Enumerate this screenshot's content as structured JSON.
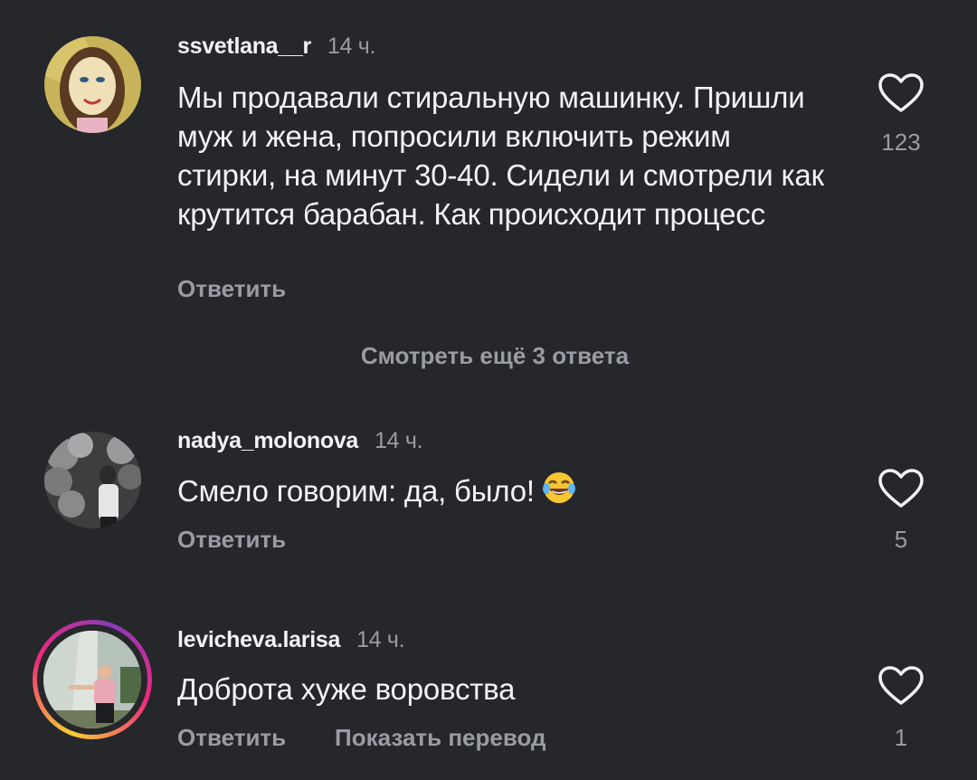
{
  "comments": [
    {
      "username": "ssvetlana__r",
      "time": "14 ч.",
      "text": "Мы продавали стиральную машинку. Пришли муж и жена, попросили включить режим стирки, на минут 30-40. Сидели и смотрели как крутится барабан. Как происходит процесс",
      "reply_label": "Ответить",
      "like_count": "123"
    },
    {
      "username": "nadya_molonova",
      "time": "14 ч.",
      "text": "Смело говорим: да, было!",
      "emoji": "face-with-tears-of-joy",
      "reply_label": "Ответить",
      "like_count": "5"
    },
    {
      "username": "levicheva.larisa",
      "time": "14 ч.",
      "text": "Доброта хуже воровства",
      "reply_label": "Ответить",
      "translate_label": "Показать перевод",
      "like_count": "1"
    }
  ],
  "more_replies_label": "Смотреть ещё 3 ответа",
  "icons": {
    "like": "heart-outline-icon"
  },
  "colors": {
    "background": "#25272b",
    "text": "#f3f3f5",
    "muted": "#9a9ca3"
  }
}
